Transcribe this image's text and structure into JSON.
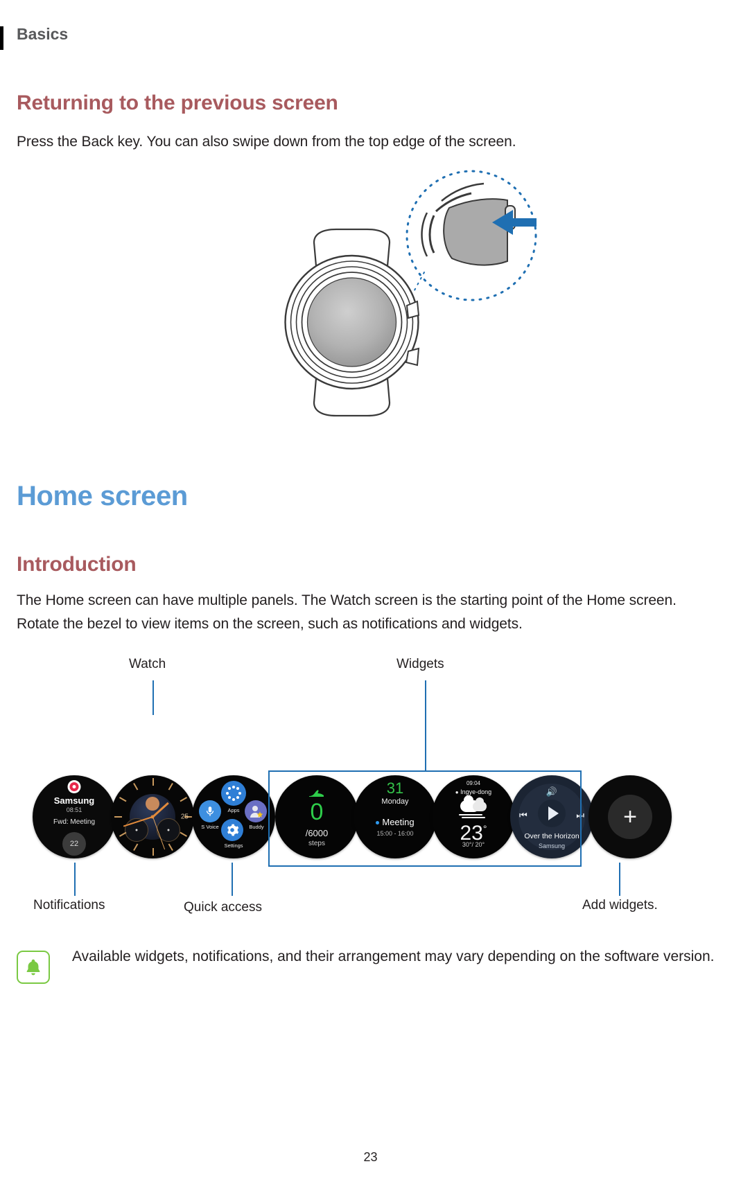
{
  "header": {
    "chapter": "Basics"
  },
  "sections": {
    "back": {
      "heading": "Returning to the previous screen",
      "paragraph": "Press the Back key. You can also swipe down from the top edge of the screen."
    },
    "home": {
      "heading": "Home screen",
      "intro_heading": "Introduction",
      "intro_paragraph": "The Home screen can have multiple panels. The Watch screen is the starting point of the Home screen. Rotate the bezel to view items on the screen, such as notifications and widgets."
    }
  },
  "callouts": {
    "watch": "Watch",
    "widgets": "Widgets",
    "notifications": "Notifications",
    "quick_access": "Quick access",
    "add_widgets": "Add widgets."
  },
  "carousel": {
    "notification": {
      "title": "Samsung",
      "time": "08:51",
      "subject": "Fwd: Meeting",
      "count": "22"
    },
    "analog": {
      "date": "25"
    },
    "quick_access": {
      "apps": "Apps",
      "s_voice": "S Voice",
      "buddy": "Buddy",
      "settings": "Settings"
    },
    "steps": {
      "count": "0",
      "goal": "/6000",
      "unit": "steps"
    },
    "calendar": {
      "day_number": "31",
      "day_name": "Monday",
      "event": "Meeting",
      "event_time": "15:00 - 16:00"
    },
    "weather": {
      "time": "09:04",
      "location": "Ingye-dong",
      "temperature": "23",
      "degree": "°",
      "range": "30°/ 20°"
    },
    "music": {
      "track": "Over the Horizon",
      "artist": "Samsung"
    },
    "add": {
      "plus": "+"
    }
  },
  "note": {
    "text": "Available widgets, notifications, and their arrangement may vary depending on the software version."
  },
  "footer": {
    "page": "23"
  },
  "colors": {
    "heading_red": "#a85a5e",
    "heading_blue": "#5b9bd5",
    "callout_blue": "#1f6fb2",
    "note_green": "#7ac943",
    "badge_red": "#e8274b",
    "steps_green": "#2ecc4a"
  }
}
